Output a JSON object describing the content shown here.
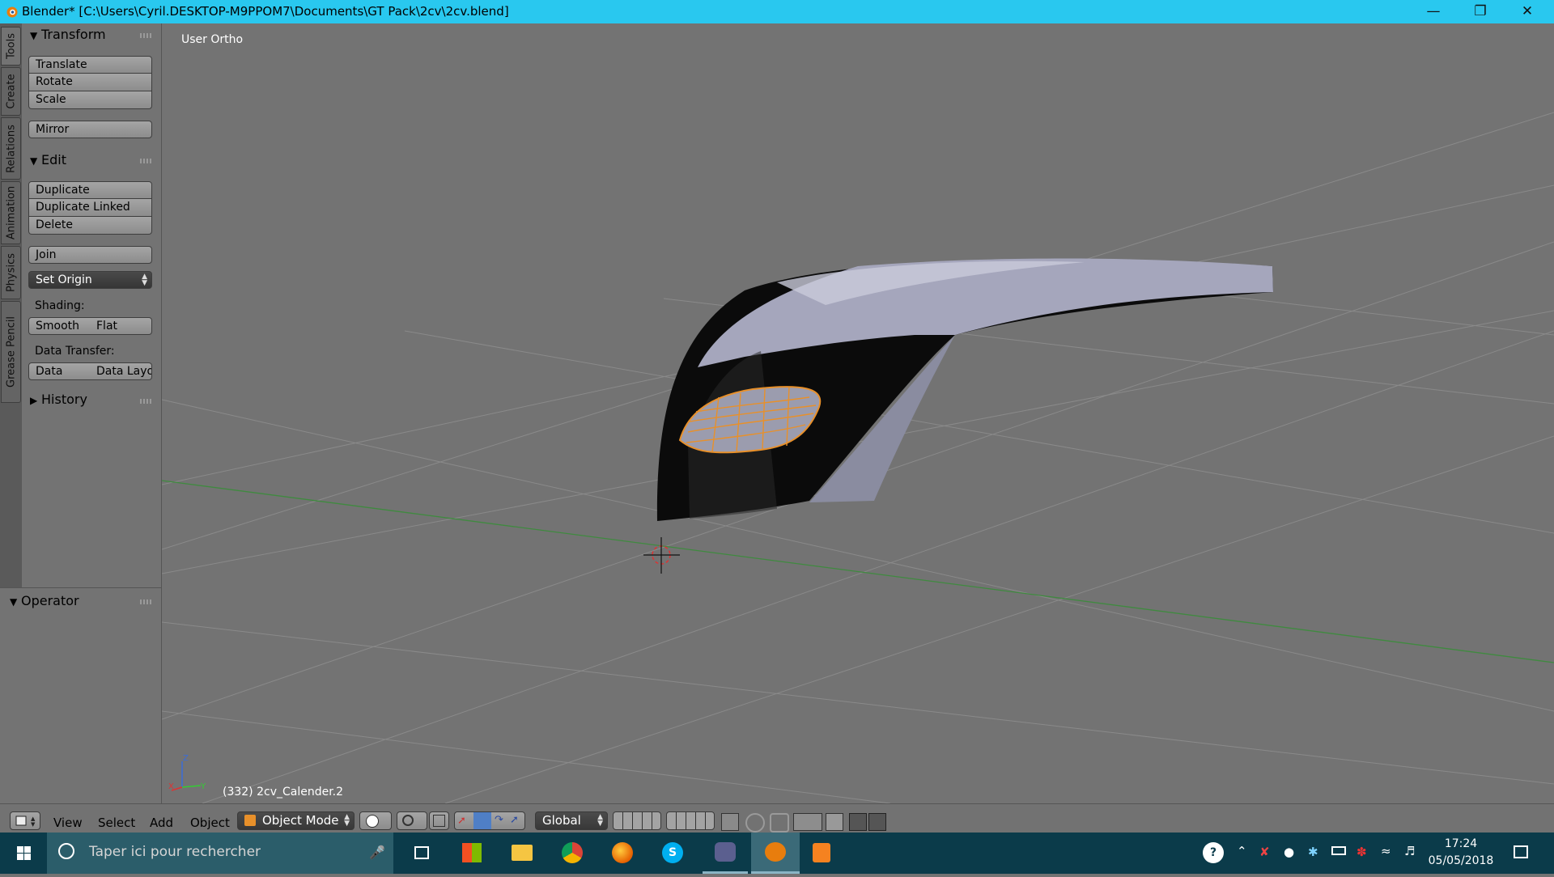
{
  "window": {
    "title": "Blender* [C:\\Users\\Cyril.DESKTOP-M9PPOM7\\Documents\\GT Pack\\2cv\\2cv.blend]",
    "controls": [
      "minimize-icon",
      "restore-icon",
      "close-icon"
    ]
  },
  "vtabs": [
    "Tools",
    "Create",
    "Relations",
    "Animation",
    "Physics",
    "Grease Pencil"
  ],
  "toolshelf": {
    "transform": {
      "title": "Transform",
      "buttons": [
        "Translate",
        "Rotate",
        "Scale"
      ],
      "mirror": "Mirror"
    },
    "edit": {
      "title": "Edit",
      "buttons": [
        "Duplicate",
        "Duplicate Linked",
        "Delete"
      ],
      "join": "Join",
      "set_origin": "Set Origin",
      "shading_label": "Shading:",
      "smooth": "Smooth",
      "flat": "Flat",
      "data_transfer_label": "Data Transfer:",
      "data": "Data",
      "data_layo": "Data Layo"
    },
    "history": {
      "title": "History"
    }
  },
  "operator": {
    "title": "Operator"
  },
  "viewport": {
    "view_name": "User Ortho",
    "object_info": "(332) 2cv_Calender.2",
    "axis_labels": [
      "Z",
      "X",
      "Y"
    ]
  },
  "header": {
    "menus": [
      "View",
      "Select",
      "Add",
      "Object"
    ],
    "mode": "Object Mode",
    "orientation": "Global"
  },
  "taskbar": {
    "search_placeholder": "Taper ici pour rechercher",
    "time": "17:24",
    "date": "05/05/2018"
  },
  "colors": {
    "titlebar": "#29c8ef",
    "viewport": "#737373",
    "selection_orange": "#e8902a",
    "taskbar": "#0b3b4a"
  }
}
